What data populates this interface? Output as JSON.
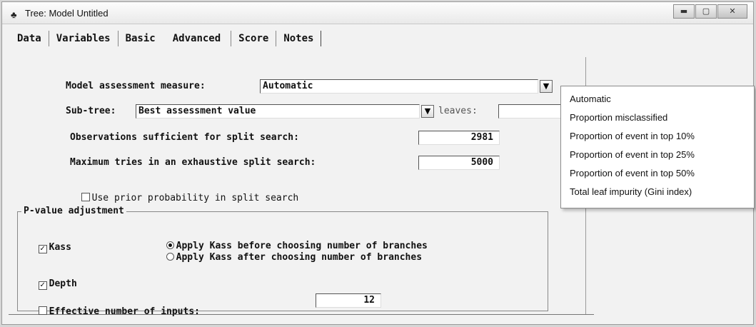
{
  "window": {
    "title": "Tree: Model Untitled",
    "icon": "tree-icon",
    "controls": {
      "minimize": "▬",
      "maximize": "▢",
      "close": "✕"
    }
  },
  "tabs": [
    {
      "label": "Data"
    },
    {
      "label": "Variables"
    },
    {
      "label": "Basic"
    },
    {
      "label": "Advanced",
      "active": true
    },
    {
      "label": "Score"
    },
    {
      "label": "Notes"
    }
  ],
  "form": {
    "model_assessment": {
      "label": "Model assessment measure:",
      "value": "Automatic"
    },
    "subtree": {
      "label": "Sub-tree:",
      "value": "Best assessment value",
      "leaves_label": "leaves:"
    },
    "obs_sufficient": {
      "label": "Observations sufficient for split search:",
      "value": "2981"
    },
    "max_tries": {
      "label": "Maximum tries in an exhaustive split search:",
      "value": "5000"
    },
    "use_prior": {
      "label": "Use prior probability in split search",
      "checked": false
    }
  },
  "pvalue": {
    "title": "P-value adjustment",
    "kass": {
      "label": "Kass",
      "checked": true
    },
    "kass_before": {
      "label": "Apply Kass before choosing number of branches",
      "selected": true
    },
    "kass_after": {
      "label": "Apply Kass after choosing number of branches",
      "selected": false
    },
    "depth": {
      "label": "Depth",
      "checked": true
    },
    "effective_inputs": {
      "label": "Effective number of inputs:",
      "checked": false,
      "value": "12"
    }
  },
  "dropdown_options": [
    "Automatic",
    "Proportion misclassified",
    "Proportion of event in top 10%",
    "Proportion of event in top 25%",
    "Proportion of event in top 50%",
    "Total leaf impurity (Gini index)"
  ],
  "glyphs": {
    "dropdown_arrow": "▼",
    "check": "✓"
  }
}
